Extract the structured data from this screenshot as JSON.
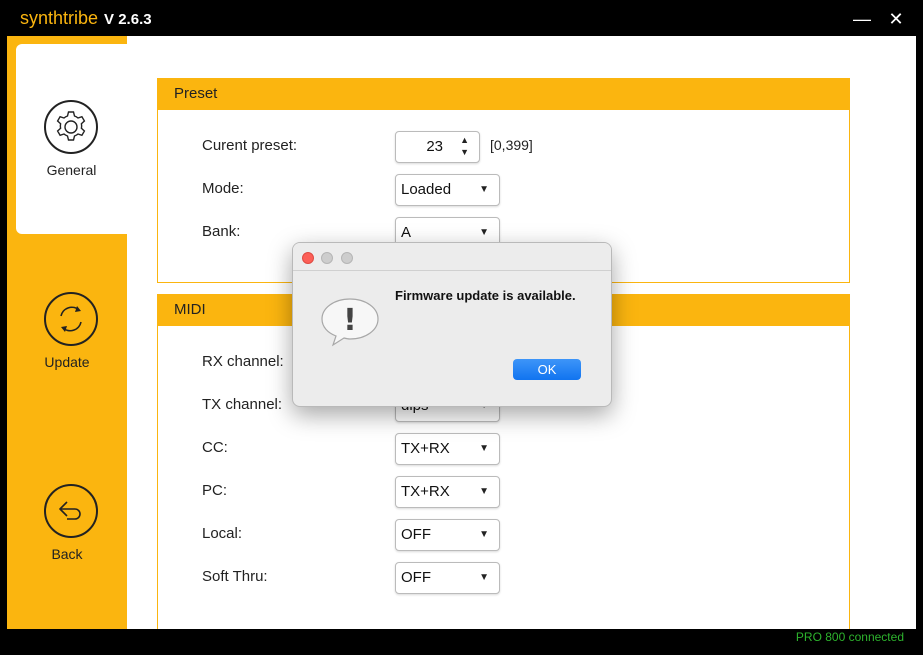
{
  "titlebar": {
    "app_name_synth": "synth",
    "app_name_tribe": "tribe",
    "version": "V 2.6.3",
    "minimize_glyph": "—",
    "close_glyph": "✕"
  },
  "sidebar": {
    "items": [
      {
        "label": "General",
        "icon": "gear-icon",
        "active": true
      },
      {
        "label": "Update",
        "icon": "refresh-icon",
        "active": false
      },
      {
        "label": "Back",
        "icon": "back-arrow-icon",
        "active": false
      }
    ]
  },
  "preset": {
    "title": "Preset",
    "current_preset_label": "Curent preset:",
    "current_preset_value": "23",
    "current_preset_range": "[0,399]",
    "mode_label": "Mode:",
    "mode_value": "Loaded",
    "bank_label": "Bank:",
    "bank_value": "A"
  },
  "midi": {
    "title": "MIDI",
    "rx_channel_label": "RX channel:",
    "tx_channel_label": "TX channel:",
    "tx_channel_value": "dips",
    "cc_label": "CC:",
    "cc_value": "TX+RX",
    "pc_label": "PC:",
    "pc_value": "TX+RX",
    "local_label": "Local:",
    "local_value": "OFF",
    "soft_thru_label": "Soft Thru:",
    "soft_thru_value": "OFF"
  },
  "dialog": {
    "message": "Firmware update is available.",
    "ok_label": "OK",
    "icon_glyph": "!"
  },
  "status": {
    "text": "PRO 800 connected"
  },
  "colors": {
    "accent": "#fbb50f",
    "status_green": "#2db32d",
    "ok_button": "#1a7ef2"
  }
}
